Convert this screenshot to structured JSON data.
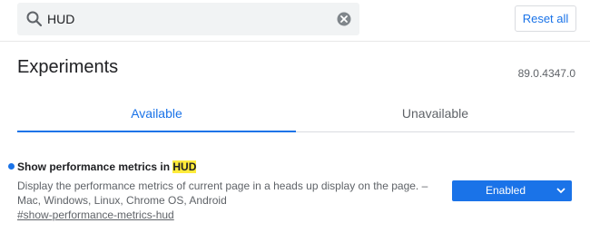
{
  "search": {
    "value": "HUD"
  },
  "header": {
    "reset_label": "Reset all"
  },
  "page": {
    "title": "Experiments",
    "version": "89.0.4347.0"
  },
  "tabs": [
    {
      "label": "Available",
      "selected": true
    },
    {
      "label": "Unavailable",
      "selected": false
    }
  ],
  "experiment": {
    "title_prefix": "Show performance metrics in ",
    "title_highlight": "HUD",
    "description": "Display the performance metrics of current page in a heads up display on the page. – Mac, Windows, Linux, Chrome OS, Android",
    "link": "#show-performance-metrics-hud",
    "selected_option": "Enabled"
  },
  "colors": {
    "accent": "#1a73e8",
    "highlight": "#ffeb3b",
    "search_bg": "#f1f3f4"
  },
  "icons": [
    "search-icon",
    "clear-icon",
    "chevron-down-icon"
  ]
}
